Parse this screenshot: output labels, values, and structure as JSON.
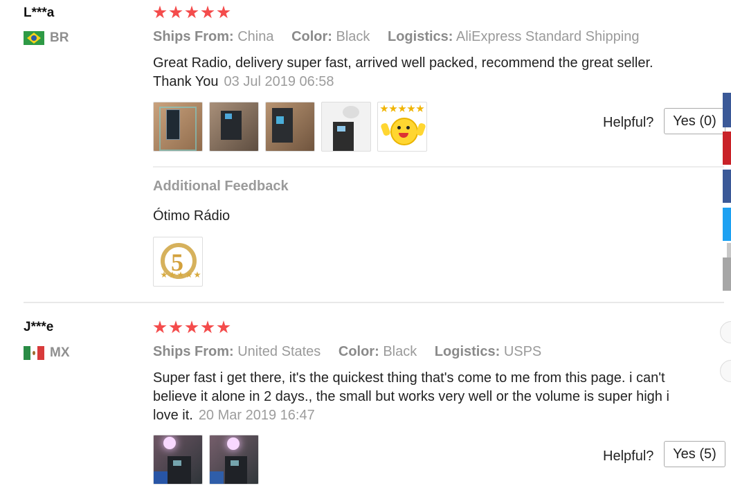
{
  "labels": {
    "ships_from": "Ships From:",
    "color": "Color:",
    "logistics": "Logistics:",
    "helpful": "Helpful?",
    "additional_feedback": "Additional Feedback"
  },
  "reviews": [
    {
      "user": "L***a",
      "country": "BR",
      "ships_from": "China",
      "color": "Black",
      "logistics": "AliExpress Standard Shipping",
      "text": "Great Radio, delivery super fast, arrived well packed, recommend the great seller. Thank You",
      "date": "03 Jul 2019 06:58",
      "helpful_button": "Yes (0)",
      "additional_feedback": "Ótimo Rádio"
    },
    {
      "user": "J***e",
      "country": "MX",
      "ships_from": "United States",
      "color": "Black",
      "logistics": "USPS",
      "text": "Super fast i get there, it's the quickest thing that's come to me from this page. i can't believe it alone in 2 days., the small but works very well or the volume is super high i love it.",
      "date": "20 Mar 2019 16:47",
      "helpful_button": "Yes (5)"
    }
  ],
  "colors": {
    "star": "#f44c4c",
    "side_blue": "#3b5998",
    "side_red": "#c92228",
    "side_cyan": "#1da1f2",
    "side_gray": "#a6a6a6"
  }
}
